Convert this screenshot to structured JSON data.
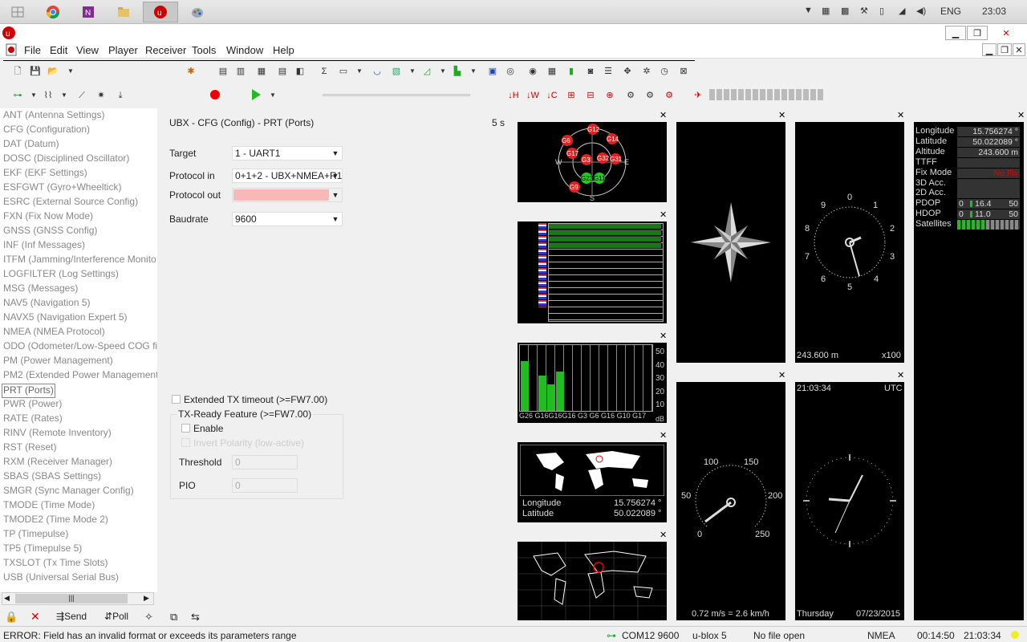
{
  "taskbar": {
    "lang": "ENG",
    "time": "23:03"
  },
  "menu": [
    "File",
    "Edit",
    "View",
    "Player",
    "Receiver",
    "Tools",
    "Window",
    "Help"
  ],
  "tree": [
    "ANT (Antenna Settings)",
    "CFG (Configuration)",
    "DAT (Datum)",
    "DOSC (Disciplined Oscillator)",
    "EKF (EKF Settings)",
    "ESFGWT (Gyro+Wheeltick)",
    "ESRC (External Source Config)",
    "FXN (Fix Now Mode)",
    "GNSS (GNSS Config)",
    "INF (Inf Messages)",
    "ITFM (Jamming/Interference Monito",
    "LOGFILTER (Log Settings)",
    "MSG (Messages)",
    "NAV5 (Navigation 5)",
    "NAVX5 (Navigation Expert 5)",
    "NMEA (NMEA Protocol)",
    "ODO (Odometer/Low-Speed COG fi",
    "PM (Power Management)",
    "PM2 (Extended Power Management",
    "PRT (Ports)",
    "PWR (Power)",
    "RATE (Rates)",
    "RINV (Remote Inventory)",
    "RST (Reset)",
    "RXM (Receiver Manager)",
    "SBAS (SBAS Settings)",
    "SMGR (Sync Manager Config)",
    "TMODE (Time Mode)",
    "TMODE2 (Time Mode 2)",
    "TP (Timepulse)",
    "TP5 (Timepulse 5)",
    "TXSLOT (Tx Time Slots)",
    "USB (Universal Serial Bus)"
  ],
  "cfg": {
    "title": "UBX - CFG (Config) - PRT (Ports)",
    "interval": "5 s",
    "target_label": "Target",
    "target_value": "1 - UART1",
    "proto_in_label": "Protocol in",
    "proto_in_value": "0+1+2 - UBX+NMEA+R1",
    "proto_out_label": "Protocol out",
    "proto_out_value": "",
    "baud_label": "Baudrate",
    "baud_value": "9600",
    "ext_tx": "Extended TX timeout (>=FW7.00)",
    "txready": "TX-Ready Feature (>=FW7.00)",
    "enable": "Enable",
    "invert": "Invert Polarity (low-active)",
    "threshold_label": "Threshold",
    "threshold_value": "0",
    "pio_label": "PIO",
    "pio_value": "0"
  },
  "sky": {
    "sats": [
      "G12",
      "G6",
      "G14",
      "G17",
      "G3",
      "G32",
      "G31",
      "G23",
      "G11",
      "G9"
    ],
    "w": "W",
    "e": "E",
    "s": "S"
  },
  "signal": {
    "bars": [
      38,
      0,
      27,
      20,
      30,
      0,
      0,
      0,
      0,
      0,
      0,
      0,
      0,
      0,
      0
    ],
    "labels": "G26 G16G16G16 G3 G6 G16 G10 G17",
    "scale": [
      "50",
      "40",
      "30",
      "20",
      "10",
      "dB"
    ]
  },
  "map1": {
    "lon_label": "Longitude",
    "lon": "15.756274 °",
    "lat_label": "Latitude",
    "lat": "50.022089 °"
  },
  "altclock": {
    "alt": "243.600 m",
    "mult": "x100",
    "digits": [
      "0",
      "1",
      "2",
      "3",
      "4",
      "5",
      "6",
      "7",
      "8",
      "9"
    ]
  },
  "speed": {
    "text": "0.72 m/s = 2.6 km/h",
    "ticks": [
      "0",
      "50",
      "100",
      "150",
      "200",
      "250"
    ]
  },
  "clock": {
    "time": "21:03:34",
    "tz": "UTC",
    "day": "Thursday",
    "date": "07/23/2015"
  },
  "info": {
    "labels": [
      "Longitude",
      "Latitude",
      "Altitude",
      "TTFF",
      "Fix Mode",
      "3D Acc.",
      "2D Acc.",
      "PDOP",
      "HDOP",
      "Satellites"
    ],
    "values": [
      "15.756274 °",
      "50.022089 °",
      "243.600 m",
      "",
      "No Fix",
      "",
      "",
      "16.4",
      "11.0",
      ""
    ],
    "pdop_min": "0",
    "pdop_max": "50",
    "hdop_min": "0",
    "hdop_max": "50"
  },
  "bottom": {
    "send": "Send",
    "poll": "Poll"
  },
  "status": {
    "error": "ERROR: Field has an invalid format or exceeds its parameters range",
    "port": "COM12 9600",
    "device": "u-blox 5",
    "file": "No file open",
    "proto": "NMEA",
    "elapsed": "00:14:50",
    "time": "21:03:34"
  },
  "colors": {
    "accent": "#cc0000",
    "green": "#22aa22",
    "pink": "#f8b8b8"
  }
}
